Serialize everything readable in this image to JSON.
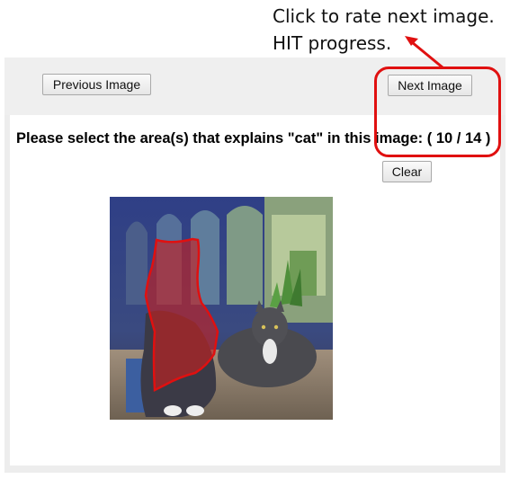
{
  "annotations": {
    "next_hint": "Click to rate next image.",
    "progress_hint": "HIT progress."
  },
  "toolbar": {
    "previous_label": "Previous Image",
    "next_label": "Next Image"
  },
  "task": {
    "prompt_prefix": "Please select the area(s) that explains ",
    "target": "\"cat\"",
    "prompt_suffix": " in this image: ",
    "progress": "( 10 / 14 )",
    "clear_label": "Clear"
  },
  "colors": {
    "annotation_red": "#e01010",
    "selection_fill": "#c81e1e",
    "background": "#efefef"
  }
}
